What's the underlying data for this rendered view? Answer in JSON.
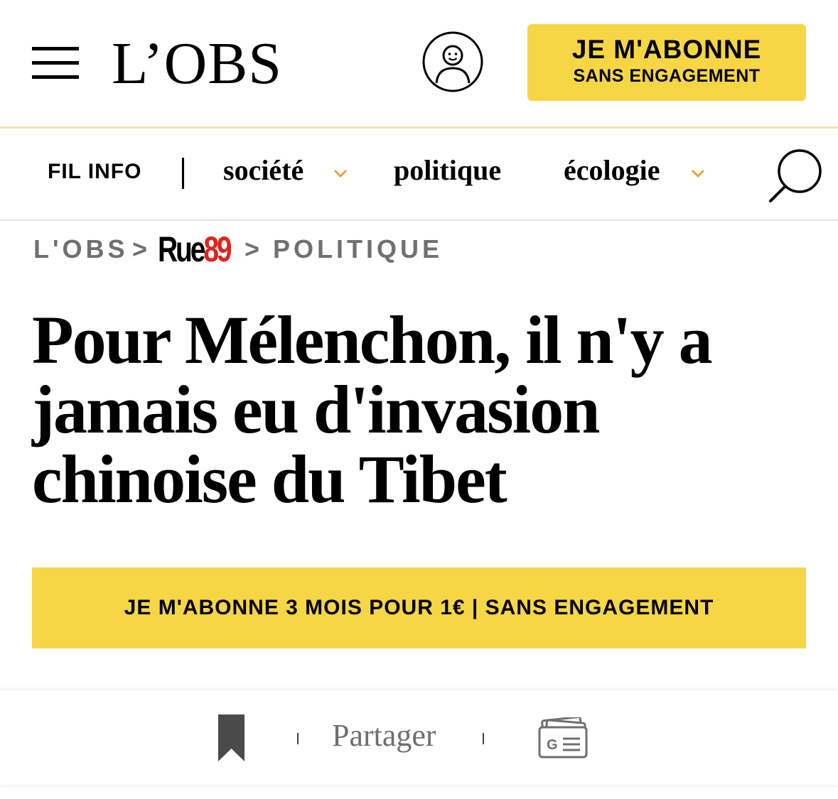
{
  "header": {
    "logo": "L’OBS",
    "subscribe_line1": "JE M'ABONNE",
    "subscribe_line2": "SANS ENGAGEMENT"
  },
  "nav": {
    "fil_info": "FIL INFO",
    "items": [
      {
        "label": "société",
        "has_dropdown": true
      },
      {
        "label": "politique",
        "has_dropdown": false
      },
      {
        "label": "écologie",
        "has_dropdown": true
      }
    ]
  },
  "breadcrumb": {
    "home": "L'OBS",
    "separator": ">",
    "section_logo_part1": "Rue",
    "section_logo_part2": "89",
    "current": "POLITIQUE"
  },
  "article": {
    "headline": "Pour Mélenchon, il n'y a jamais eu d'invasion chinoise du Tibet"
  },
  "promo": {
    "label": "JE M'ABONNE 3 MOIS POUR 1€ | SANS ENGAGEMENT"
  },
  "action_bar": {
    "share_label": "Partager"
  },
  "colors": {
    "accent_yellow": "#f6d645",
    "chevron_orange": "#e8a33a",
    "rue89_red": "#e2231a",
    "breadcrumb_gray": "#707070"
  },
  "icons": [
    "menu-icon",
    "account-icon",
    "search-icon",
    "chevron-down-icon",
    "bookmark-icon",
    "google-news-icon"
  ]
}
